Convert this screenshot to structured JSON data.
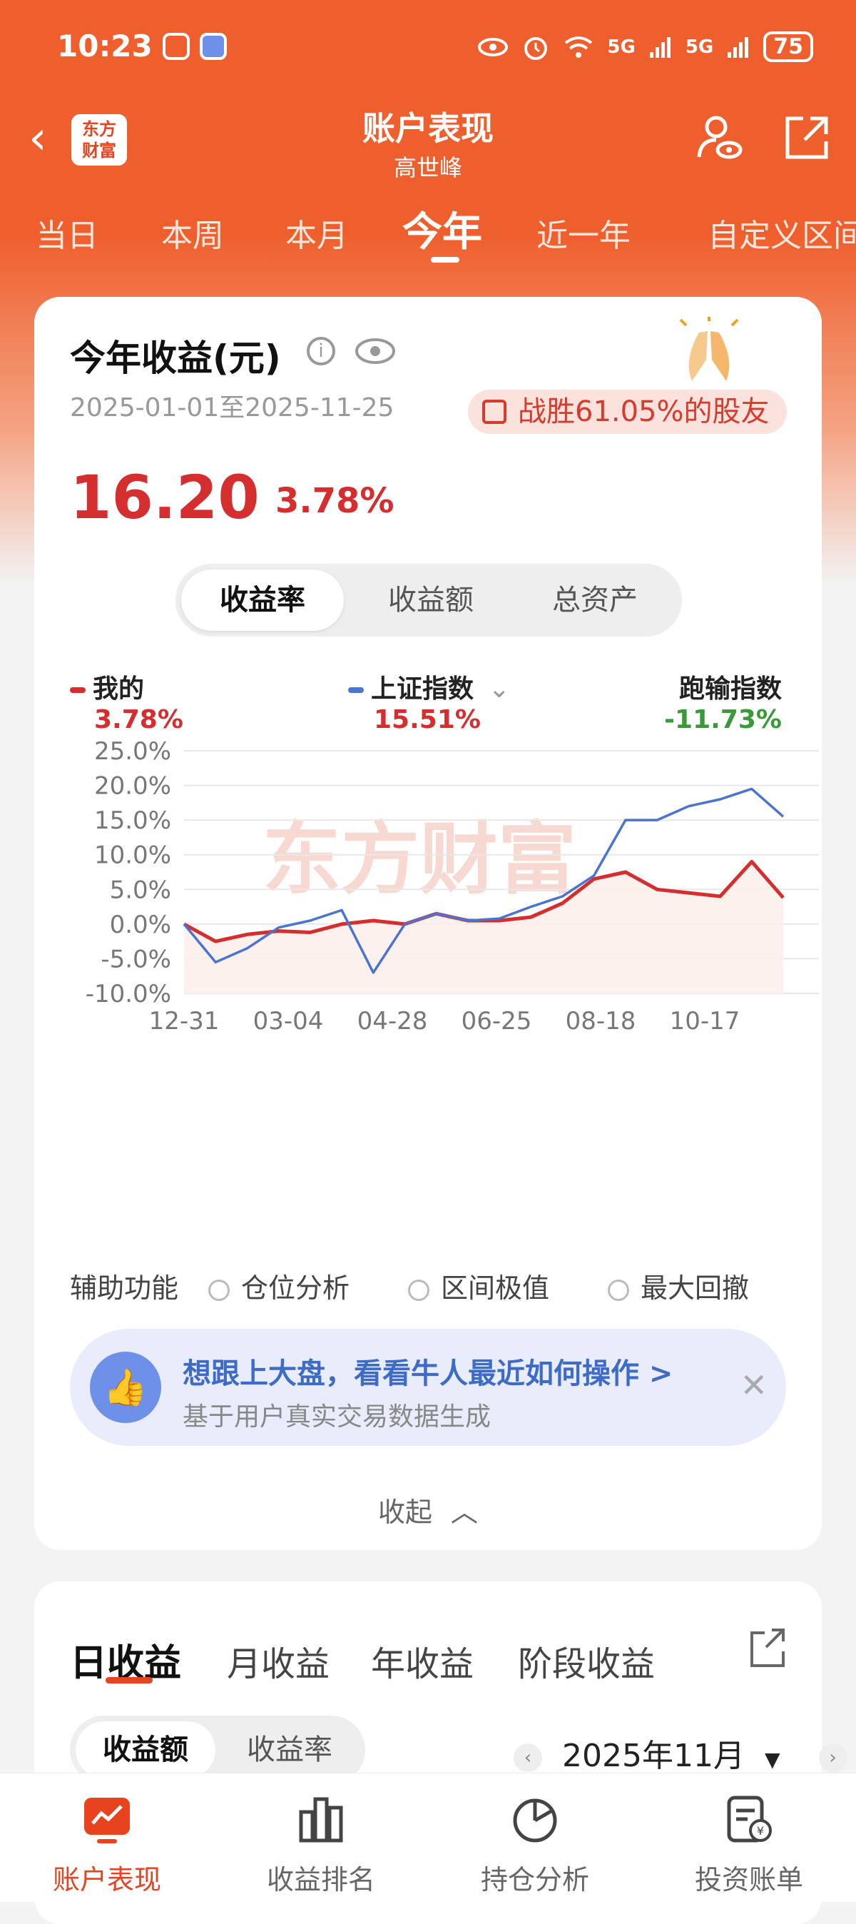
{
  "status_bar": {
    "time": "10:23",
    "battery": "75",
    "network": [
      "5G",
      "5G"
    ]
  },
  "nav": {
    "logo_text": "东方财富",
    "title": "账户表现",
    "subtitle": "高世峰"
  },
  "periods": [
    "当日",
    "本周",
    "本月",
    "今年",
    "近一年",
    "自定义区间"
  ],
  "active_period": "今年",
  "summary": {
    "title": "今年收益(元)",
    "date_range": "2025-01-01至2025-11-25",
    "beat_text": "战胜61.05%的股友",
    "amount": "16.20",
    "percent": "3.78%"
  },
  "chart_tabs": [
    "收益率",
    "收益额",
    "总资产"
  ],
  "legend": {
    "mine": {
      "label": "我的",
      "value": "3.78%",
      "color": "#d42e2e"
    },
    "index": {
      "label": "上证指数",
      "value": "15.51%",
      "color": "#4a74cf"
    },
    "diff": {
      "label": "跑输指数",
      "value": "-11.73%",
      "color": "#3a9a3a"
    }
  },
  "chart_data": {
    "type": "line",
    "watermark": "东方财富",
    "y_ticks": [
      "25.0%",
      "20.0%",
      "15.0%",
      "10.0%",
      "5.0%",
      "0.0%",
      "-5.0%",
      "-10.0%"
    ],
    "x_ticks": [
      "12-31",
      "03-04",
      "04-28",
      "06-25",
      "08-18",
      "10-17"
    ],
    "ylim": [
      -10,
      25
    ],
    "x_points": 20,
    "series": [
      {
        "name": "我的",
        "color": "#d42e2e",
        "values": [
          0,
          -2.5,
          -1.5,
          -1.0,
          -1.2,
          0,
          0.5,
          0,
          1.5,
          0.5,
          0.5,
          1.0,
          3.0,
          6.5,
          7.5,
          5.0,
          4.5,
          4.0,
          9.0,
          3.8
        ]
      },
      {
        "name": "上证指数",
        "color": "#4a74cf",
        "values": [
          0,
          -5.5,
          -3.5,
          -0.5,
          0.5,
          2.0,
          -7.0,
          0,
          1.5,
          0.5,
          0.8,
          2.5,
          4.0,
          7.0,
          15.0,
          15.0,
          17.0,
          18.0,
          19.5,
          15.5
        ]
      }
    ]
  },
  "aux": {
    "label": "辅助功能",
    "options": [
      "仓位分析",
      "区间极值",
      "最大回撤"
    ]
  },
  "promo": {
    "title": "想跟上大盘，看看牛人最近如何操作 >",
    "subtitle": "基于用户真实交易数据生成"
  },
  "collapse_label": "收起",
  "earnings_tabs": [
    "日收益",
    "月收益",
    "年收益",
    "阶段收益"
  ],
  "earnings_toggle": [
    "收益额",
    "收益率"
  ],
  "month_label": "2025年11月",
  "tabbar": [
    "账户表现",
    "收益排名",
    "持仓分析",
    "投资账单"
  ]
}
